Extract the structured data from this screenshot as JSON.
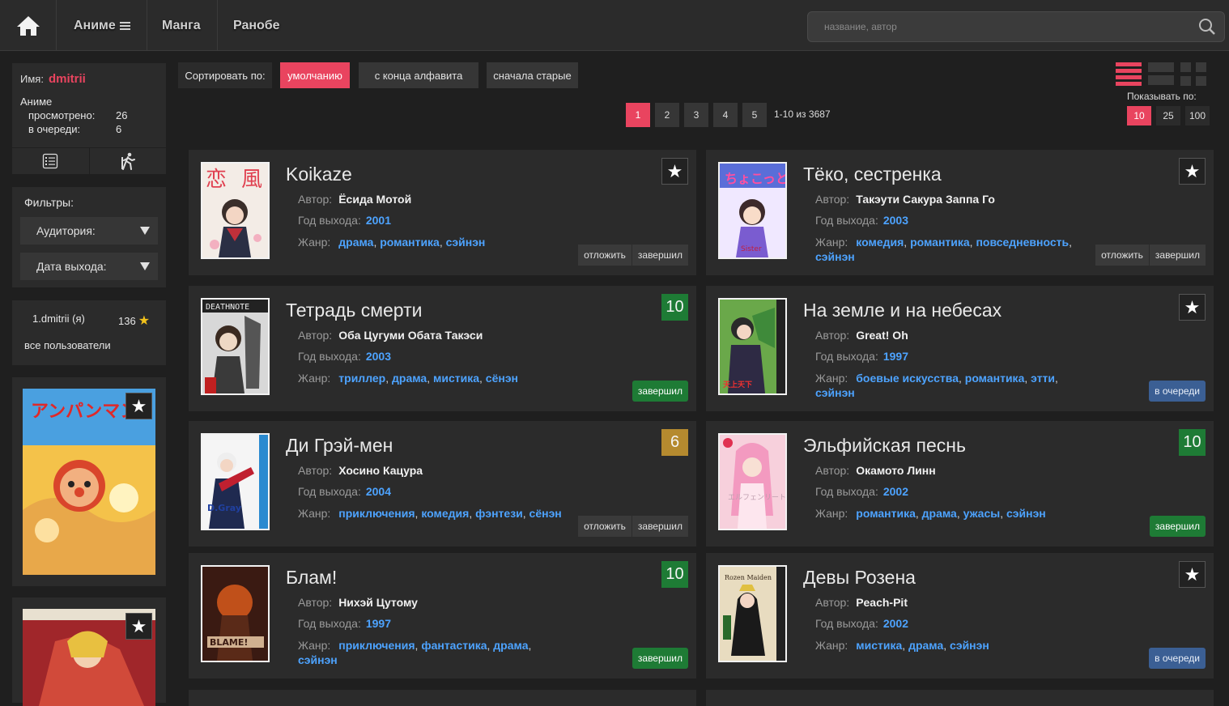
{
  "nav": {
    "anime": "Аниме",
    "manga": "Манга",
    "ranobe": "Ранобе",
    "search_placeholder": "название, автор"
  },
  "profile": {
    "name_label": "Имя:",
    "username": "dmitrii",
    "section": "Аниме",
    "watched_label": "просмотрено:",
    "watched": "26",
    "queue_label": "в очереди:",
    "queue": "6"
  },
  "filters": {
    "title": "Фильтры:",
    "audience": "Аудитория:",
    "release_date": "Дата выхода:"
  },
  "users": {
    "entry": "1.dmitrii (я)",
    "score": "136",
    "all": "все пользователи"
  },
  "sort": {
    "label": "Сортировать по:",
    "default": "умолчанию",
    "alpha_desc": "с конца алфавита",
    "oldest": "сначала старые"
  },
  "pagination": {
    "pages": [
      "1",
      "2",
      "3",
      "4",
      "5"
    ],
    "current": "1",
    "info": "1-10 из 3687"
  },
  "per_page": {
    "label": "Показывать по:",
    "options": [
      "10",
      "25",
      "100"
    ],
    "current": "10"
  },
  "labels": {
    "author": "Автор:",
    "year": "Год выхода:",
    "genre": "Жанр:",
    "postpone": "отложить",
    "finished": "завершил",
    "in_queue": "в очереди"
  },
  "cards": [
    {
      "title": "Koikaze",
      "author": "Ёсида Мотой",
      "year": "2001",
      "genres": [
        "драма",
        "романтика",
        "сэйнэн"
      ],
      "score": null,
      "status": "actions"
    },
    {
      "title": "Тёко, сестренка",
      "author": "Такэути Сакура  Заппа Го",
      "year": "2003",
      "genres": [
        "комедия",
        "романтика",
        "повседневность",
        "сэйнэн"
      ],
      "score": null,
      "status": "actions"
    },
    {
      "title": "Тетрадь смерти",
      "author": "Оба Цугуми  Обата Такэси",
      "year": "2003",
      "genres": [
        "триллер",
        "драма",
        "мистика",
        "сёнэн"
      ],
      "score": "10",
      "status": "done"
    },
    {
      "title": "На земле и на небесах",
      "author": "Great! Oh",
      "year": "1997",
      "genres": [
        "боевые искусства",
        "романтика",
        "этти",
        "сэйнэн"
      ],
      "score": null,
      "status": "queue"
    },
    {
      "title": "Ди Грэй-мен",
      "author": "Хосино Кацура",
      "year": "2004",
      "genres": [
        "приключения",
        "комедия",
        "фэнтези",
        "сёнэн"
      ],
      "score": "6",
      "status": "actions"
    },
    {
      "title": "Эльфийская песнь",
      "author": "Окамото Линн",
      "year": "2002",
      "genres": [
        "романтика",
        "драма",
        "ужасы",
        "сэйнэн"
      ],
      "score": "10",
      "status": "done"
    },
    {
      "title": "Блам!",
      "author": "Нихэй Цутому",
      "year": "1997",
      "genres": [
        "приключения",
        "фантастика",
        "драма",
        "сэйнэн"
      ],
      "score": "10",
      "status": "done"
    },
    {
      "title": "Девы Розена",
      "author": "Peach-Pit",
      "year": "2002",
      "genres": [
        "мистика",
        "драма",
        "сэйнэн"
      ],
      "score": null,
      "status": "queue"
    }
  ],
  "colors": {
    "accent": "#e9445f",
    "link": "#4da3ff",
    "score_green": "#1e7b35",
    "score_gold": "#b58a2f",
    "queue_blue": "#3b5f94"
  }
}
